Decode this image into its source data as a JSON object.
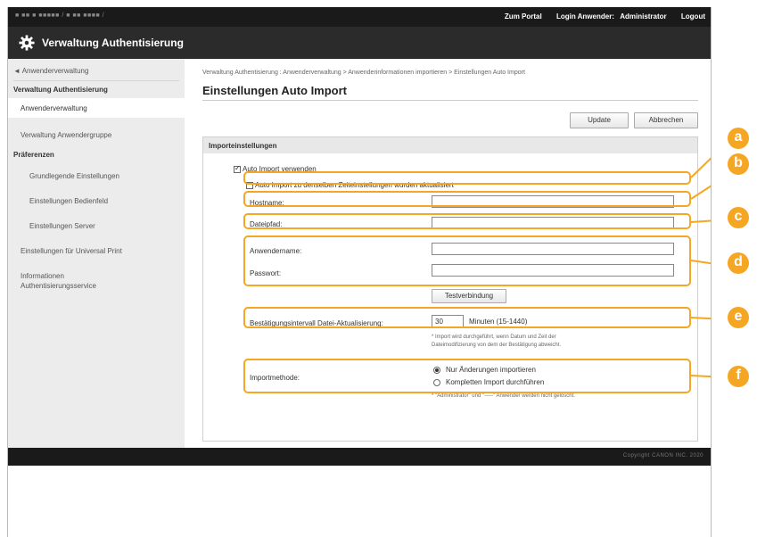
{
  "topbar": {
    "device": "■ ■■ ■ ■■■■■ / ■ ■■ ■■■■ /",
    "portal_label": "Zum Portal",
    "login_label": "Login Anwender:",
    "user_name": "Administrator",
    "logout_label": "Logout"
  },
  "app": {
    "title": "Verwaltung Authentisierung",
    "gear_icon": "gear-icon"
  },
  "sidebar": {
    "back": "◄ Anwenderverwaltung",
    "section_title": "Verwaltung Authentisierung",
    "items": [
      "Anwenderverwaltung",
      "Verwaltung Anwendergruppe"
    ],
    "prefs_title": "Präferenzen",
    "prefs_items": [
      "Grundlegende Einstellungen",
      "Einstellungen Bedienfeld",
      "Einstellungen Server"
    ],
    "universal_print": "Einstellungen für Universal Print",
    "info_line1": "Informationen",
    "info_line2": "Authentisierungsservice"
  },
  "breadcrumb": "Verwaltung Authentisierung : Anwenderverwaltung > Anwenderinformationen importieren > Einstellungen Auto Import",
  "page_title": "Einstellungen Auto Import",
  "buttons": {
    "update": "Update",
    "cancel": "Abbrechen",
    "test_connection": "Testverbindung"
  },
  "panel": {
    "heading": "Importeinstellungen",
    "use_auto_import": "Auto Import verwenden",
    "use_auto_import_checked": true,
    "same_time_update": "Auto Import zu denselben Zeiteinstellungen wurden aktualisiert",
    "same_time_update_checked": false,
    "hostname_label": "Hostname:",
    "hostname_value": "",
    "filepath_label": "Dateipfad:",
    "filepath_value": "",
    "username_label": "Anwendername:",
    "username_value": "",
    "password_label": "Passwort:",
    "password_value": "",
    "interval_label": "Bestätigungsintervall Datei-Aktualisierung:",
    "interval_value": "30",
    "interval_unit": "Minuten (15-1440)",
    "interval_note_1": "* Import wird durchgeführt, wenn Datum und Zeit der",
    "interval_note_2": "Dateimodifizierung von dem der Bestätigung abweicht.",
    "method_label": "Importmethode:",
    "method_options": [
      "Nur Änderungen importieren",
      "Kompletten Import durchführen"
    ],
    "method_selected": 0,
    "method_note": "* \"Administrator\" und \"-----\" Anwender werden nicht gelöscht."
  },
  "scroll_top_icon": "scroll-to-top-icon",
  "footer_copyright": "Copyright CANON INC. 2020",
  "callouts": [
    "a",
    "b",
    "c",
    "d",
    "e",
    "f"
  ],
  "accent_color": "#f5a623"
}
